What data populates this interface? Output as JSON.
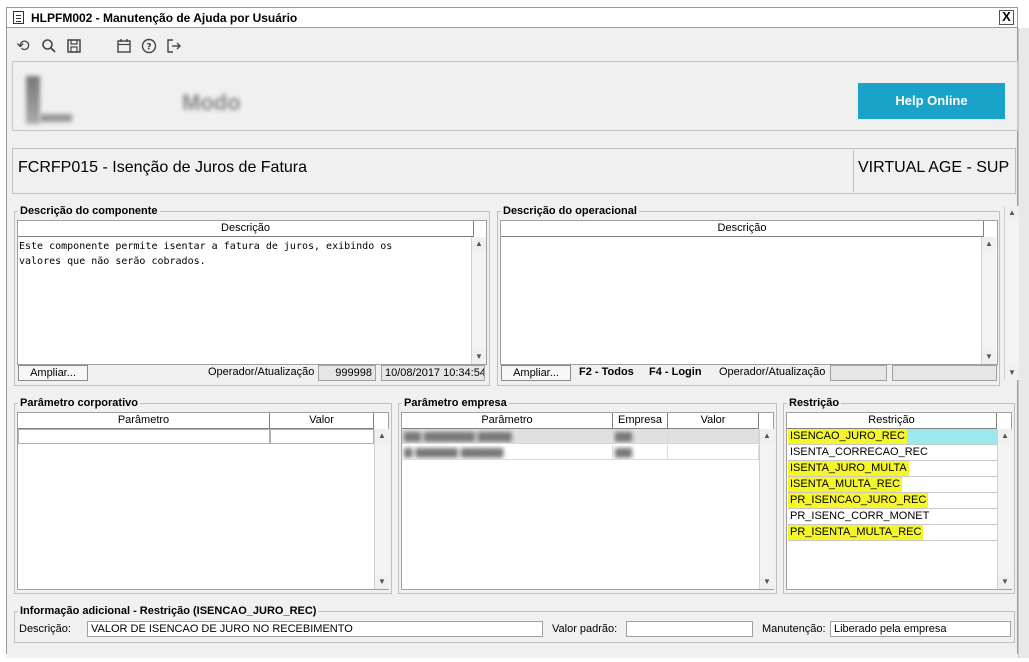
{
  "window": {
    "title": "HLPFM002 - Manutenção de Ajuda por Usuário",
    "close_label": "X"
  },
  "toolbar": {
    "icons": [
      "undo-icon",
      "search-icon",
      "save-icon",
      "calendar-icon",
      "help-icon",
      "exit-icon"
    ],
    "glyphs": {
      "undo": "⟲",
      "search": "🔍",
      "save": "💾",
      "calendar": "📅",
      "help": "?",
      "exit": "⇥"
    }
  },
  "header": {
    "help_button": "Help Online",
    "accent": "#1aa3c8"
  },
  "component": {
    "title": "FCRFP015 - Isenção de Juros de Fatura",
    "company": "VIRTUAL AGE - SUP"
  },
  "desc_componente": {
    "legend": "Descrição do componente",
    "col": "Descrição",
    "text": "Este componente permite isentar a fatura de juros, exibindo os\nvalores que não serão cobrados.",
    "ampliar": "Ampliar...",
    "operador_label": "Operador/Atualização",
    "operador": "999998",
    "atualizacao": "10/08/2017 10:34:54"
  },
  "desc_operacional": {
    "legend": "Descrição do operacional",
    "col": "Descrição",
    "ampliar": "Ampliar...",
    "f2": "F2 - Todos",
    "f4": "F4 - Login",
    "operador_label": "Operador/Atualização"
  },
  "param_corporativo": {
    "legend": "Parâmetro corporativo",
    "cols": [
      "Parâmetro",
      "Valor"
    ]
  },
  "param_empresa": {
    "legend": "Parâmetro empresa",
    "cols": [
      "Parâmetro",
      "Empresa",
      "Valor"
    ]
  },
  "restricao": {
    "legend": "Restrição",
    "col": "Restrição",
    "rows": [
      {
        "text": "ISENCAO_JURO_REC",
        "highlight": true,
        "selected": true
      },
      {
        "text": "ISENTA_CORRECAO_REC",
        "highlight": false
      },
      {
        "text": "ISENTA_JURO_MULTA",
        "highlight": true
      },
      {
        "text": "ISENTA_MULTA_REC",
        "highlight": true
      },
      {
        "text": "PR_ISENCAO_JURO_REC",
        "highlight": true
      },
      {
        "text": "PR_ISENC_CORR_MONET",
        "highlight": false
      },
      {
        "text": "PR_ISENTA_MULTA_REC",
        "highlight": true
      }
    ]
  },
  "info": {
    "legend": "Informação adicional - Restrição (ISENCAO_JURO_REC)",
    "descricao_label": "Descrição:",
    "descricao": "VALOR DE ISENCAO DE JURO NO RECEBIMENTO",
    "valor_padrao_label": "Valor padrão:",
    "valor_padrao": "",
    "manutencao_label": "Manutenção:",
    "manutencao": "Liberado pela empresa"
  }
}
